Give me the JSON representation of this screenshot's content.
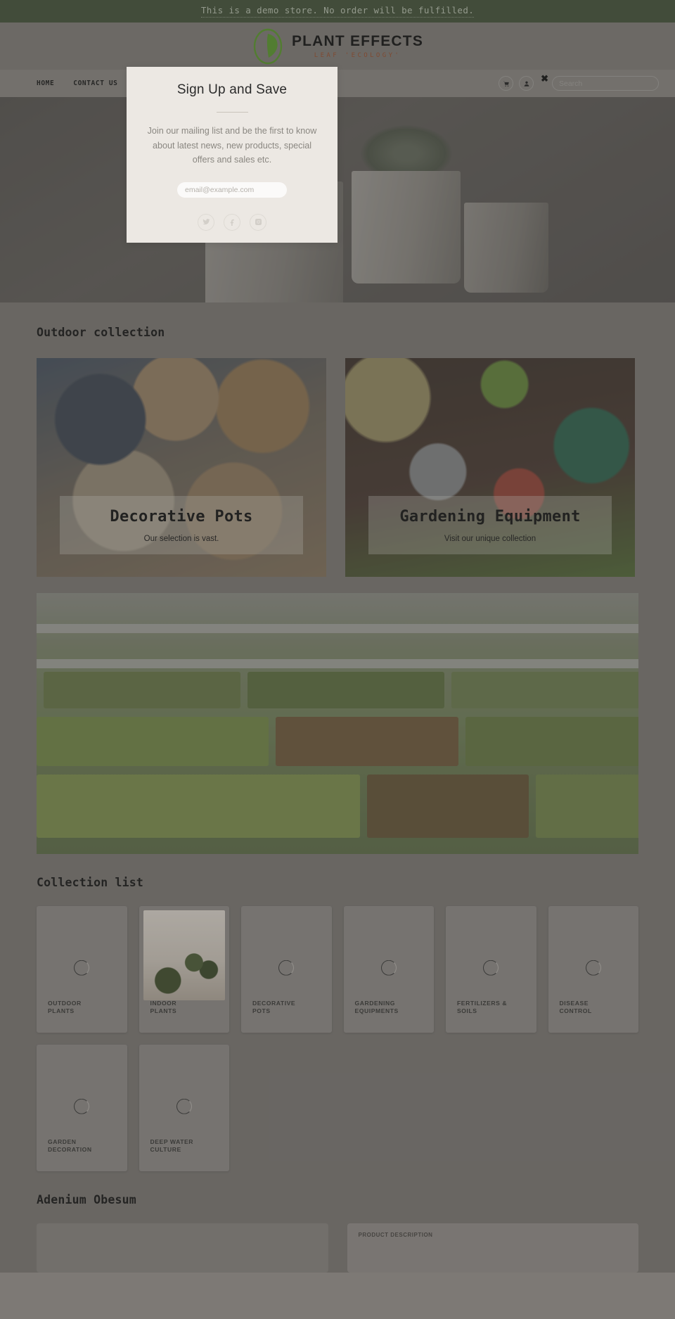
{
  "announcement": {
    "text": "This is a demo store. No order will be fulfilled."
  },
  "brand": {
    "name": "PLANT EFFECTS",
    "tagline": "LEAF 'ECOLOGY'",
    "mark_color": "#5c9a2e",
    "tagline_color": "#9c5130"
  },
  "nav": {
    "links": [
      {
        "label": "Home",
        "name": "nav-link-home"
      },
      {
        "label": "Contact us",
        "name": "nav-link-contact-us"
      }
    ],
    "cart_icon": "cart-icon",
    "account_icon": "account-icon",
    "close_label": "✖"
  },
  "search": {
    "placeholder": "Search",
    "value": "",
    "icon": "search-icon"
  },
  "modal": {
    "title": "Sign Up and Save",
    "body": "Join our mailing list and be the first to know about latest news, new products, special offers and sales etc.",
    "email_placeholder": "email@example.com",
    "email_value": "",
    "submit_icon": "check-icon",
    "socials": [
      {
        "name": "twitter-icon",
        "label": "Twitter"
      },
      {
        "name": "facebook-icon",
        "label": "Facebook"
      },
      {
        "name": "instagram-icon",
        "label": "Instagram"
      }
    ]
  },
  "outdoor": {
    "title": "Outdoor collection",
    "cards": [
      {
        "title": "Decorative Pots",
        "subtitle": "Our selection is vast.",
        "name": "promo-card-decorative-pots"
      },
      {
        "title": "Gardening Equipment",
        "subtitle": "Visit our unique collection",
        "name": "promo-card-gardening-equipment"
      }
    ]
  },
  "collection": {
    "title": "Collection list",
    "items": [
      {
        "label": "OUTDOOR\nPLANTS",
        "has_image": false
      },
      {
        "label": "INDOOR\nPLANTS",
        "has_image": true
      },
      {
        "label": "DECORATIVE\nPOTS",
        "has_image": false
      },
      {
        "label": "GARDENING\nEQUIPMENTS",
        "has_image": false
      },
      {
        "label": "FERTILIZERS &\nSOILS",
        "has_image": false
      },
      {
        "label": "DISEASE\nCONTROL",
        "has_image": false
      },
      {
        "label": "GARDEN\nDECORATION",
        "has_image": false
      },
      {
        "label": "DEEP WATER\nCULTURE",
        "has_image": false
      }
    ]
  },
  "adenium": {
    "title": "Adenium Obesum",
    "cards": [
      {
        "label": ""
      },
      {
        "label": "PRODUCT DESCRIPTION"
      }
    ]
  }
}
